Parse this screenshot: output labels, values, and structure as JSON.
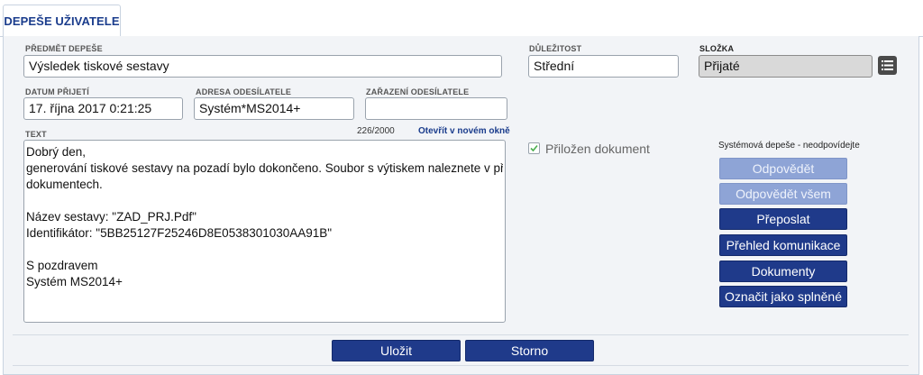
{
  "tab": {
    "label": "DEPEŠE UŽIVATELE"
  },
  "fields": {
    "subject": {
      "label": "PŘEDMĚT DEPEŠE",
      "value": "Výsledek tiskové sestavy"
    },
    "priority": {
      "label": "DŮLEŽITOST",
      "value": "Střední"
    },
    "folder": {
      "label": "SLOŽKA",
      "value": "Přijaté"
    },
    "received": {
      "label": "DATUM PŘIJETÍ",
      "value": "17. října 2017 0:21:25"
    },
    "sender_address": {
      "label": "ADRESA ODESÍLATELE",
      "value": "Systém*MS2014+"
    },
    "sender_classification": {
      "label": "ZAŘAZENÍ ODESÍLATELE",
      "value": ""
    },
    "text": {
      "label": "TEXT",
      "counter": "226/2000",
      "open_link": "Otevřít v novém okně",
      "lines": [
        "Dobrý den,",
        "generování tiskové sestavy na pozadí bylo dokončeno. Soubor s výtiskem naleznete v přiložených",
        "dokumentech.",
        "",
        "Název sestavy: \"ZAD_PRJ.Pdf\"",
        "Identifikátor: \"5BB25127F25246D8E0538301030AA91B\"",
        "",
        "S pozdravem",
        "Systém MS2014+"
      ]
    }
  },
  "attachment": {
    "label": "Přiložen dokument",
    "checked": true
  },
  "system_note": "Systémová depeše - neodpovídejte",
  "actions": {
    "reply": "Odpovědět",
    "reply_all": "Odpovědět všem",
    "forward": "Přeposlat",
    "overview": "Přehled komunikace",
    "documents": "Dokumenty",
    "mark_done": "Označit jako splněné"
  },
  "footer": {
    "save": "Uložit",
    "cancel": "Storno"
  },
  "colors": {
    "accent": "#1f3a8a",
    "accent_disabled": "#8ea4d6",
    "panel_bg": "#f2f4f7",
    "check": "#4caf50"
  },
  "icons": {
    "folder_picker": "list-icon",
    "checkbox": "checkmark-icon"
  }
}
